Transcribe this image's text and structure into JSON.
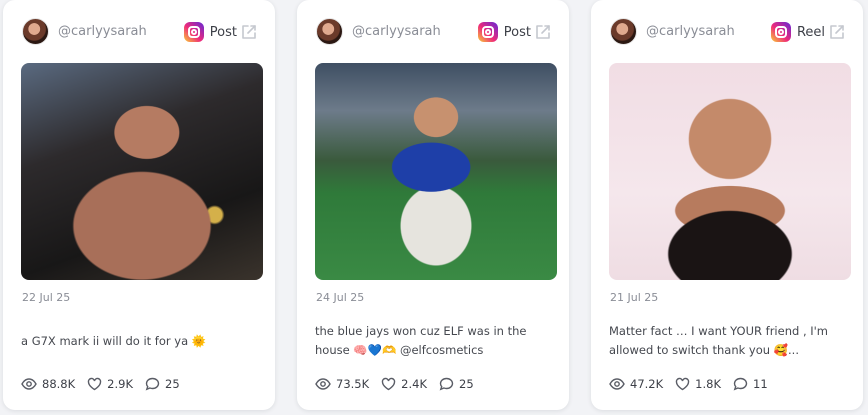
{
  "posts": [
    {
      "handle": "@carlyysarah",
      "platform": "Post",
      "platform_icon": "instagram-icon",
      "date": "22 Jul 25",
      "caption": "a G7X mark ii will do it for ya 🌞",
      "views": "88.8K",
      "likes": "2.9K",
      "comments": "25"
    },
    {
      "handle": "@carlyysarah",
      "platform": "Post",
      "platform_icon": "instagram-icon",
      "date": "24 Jul 25",
      "caption": "the blue jays won cuz ELF was in the house 🧠💙🫶 @elfcosmetics",
      "views": "73.5K",
      "likes": "2.4K",
      "comments": "25"
    },
    {
      "handle": "@carlyysarah",
      "platform": "Reel",
      "platform_icon": "instagram-icon",
      "date": "21 Jul 25",
      "caption": "Matter fact … I want YOUR friend , I'm allowed to switch thank you 🥰...",
      "views": "47.2K",
      "likes": "1.8K",
      "comments": "11"
    }
  ],
  "colors": {
    "page_bg": "#f2f3f6",
    "card_bg": "#ffffff",
    "muted_text": "#8a8d96",
    "body_text": "#45484f"
  }
}
